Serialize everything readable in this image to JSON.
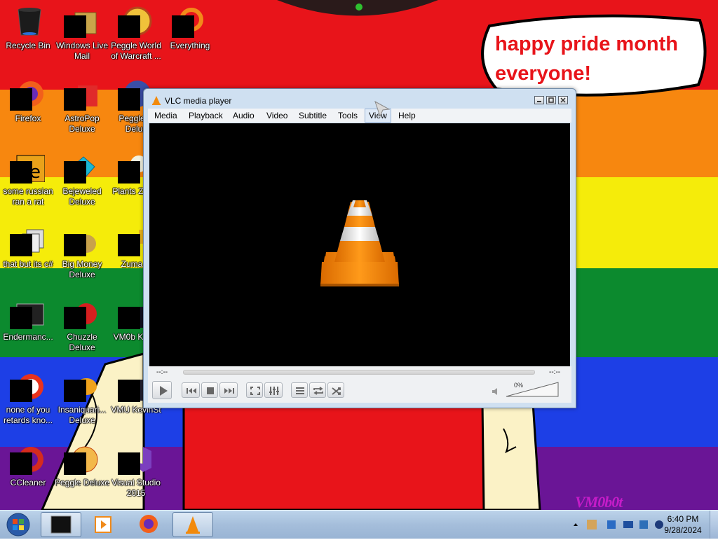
{
  "wallpaper": {
    "speech_bubble": "happy pride month everyone!",
    "signature": "VM0b0t"
  },
  "desktop_icons": [
    {
      "label": "Recycle Bin"
    },
    {
      "label": "Windows Live Mail"
    },
    {
      "label": "Peggle World of Warcraft ..."
    },
    {
      "label": "Everything"
    },
    {
      "label": "Firefox"
    },
    {
      "label": "AstroPop Deluxe"
    },
    {
      "label": "Peggle N Delux"
    },
    {
      "label": "some russian ran a rat"
    },
    {
      "label": "Bejeweled Deluxe"
    },
    {
      "label": "Plants Zomb"
    },
    {
      "label": "that but its c#"
    },
    {
      "label": "Big Money Deluxe"
    },
    {
      "label": "Zuma D"
    },
    {
      "label": "Endermanc..."
    },
    {
      "label": "Chuzzle Deluxe"
    },
    {
      "label": "VM0b Kevin"
    },
    {
      "label": "none of you retards kno..."
    },
    {
      "label": "Insaniquari... Deluxe"
    },
    {
      "label": "VMU KevinSt"
    },
    {
      "label": "CCleaner"
    },
    {
      "label": "Peggle Deluxe"
    },
    {
      "label": "Visual Studio 2015"
    }
  ],
  "vlc": {
    "title": "VLC media player",
    "menu": [
      "Media",
      "Playback",
      "Audio",
      "Video",
      "Subtitle",
      "Tools",
      "View",
      "Help"
    ],
    "time_elapsed": "--:--",
    "time_total": "--:--",
    "volume": "0%"
  },
  "taskbar": {
    "clock_time": "6:40 PM",
    "clock_date": "9/28/2024"
  }
}
